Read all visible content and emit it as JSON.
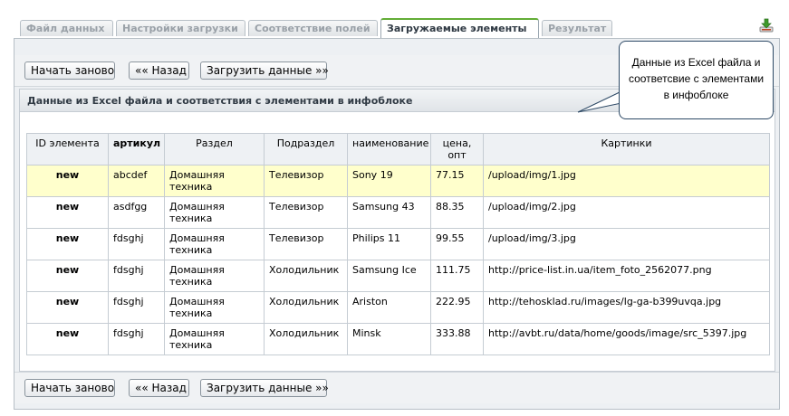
{
  "tabs": [
    {
      "label": "Файл данных",
      "active": false
    },
    {
      "label": "Настройки загрузки",
      "active": false
    },
    {
      "label": "Соответствие полей",
      "active": false
    },
    {
      "label": "Загружаемые элементы",
      "active": true
    },
    {
      "label": "Результат",
      "active": false
    }
  ],
  "toolbar": {
    "restart_label": "Начать заново",
    "back_label": "«« Назад",
    "upload_label": "Загрузить данные »»"
  },
  "section": {
    "title": "Данные из Excel файла и соответствия с элементами в инфоблоке"
  },
  "table": {
    "headers": [
      "ID элемента",
      "артикул",
      "Раздел",
      "Подраздел",
      "наименование",
      "цена, опт",
      "Картинки"
    ],
    "rows": [
      {
        "id": "new",
        "article": "abcdef",
        "section": "Домашняя техника",
        "subsection": "Телевизор",
        "name": "Sony 19",
        "price": "77.15",
        "image": "/upload/img/1.jpg",
        "highlighted": true
      },
      {
        "id": "new",
        "article": "asdfgg",
        "section": "Домашняя техника",
        "subsection": "Телевизор",
        "name": "Samsung 43",
        "price": "88.35",
        "image": "/upload/img/2.jpg",
        "highlighted": false
      },
      {
        "id": "new",
        "article": "fdsghj",
        "section": "Домашняя техника",
        "subsection": "Телевизор",
        "name": "Philips 11",
        "price": "99.55",
        "image": "/upload/img/3.jpg",
        "highlighted": false
      },
      {
        "id": "new",
        "article": "fdsghj",
        "section": "Домашняя техника",
        "subsection": "Холодильник",
        "name": "Samsung Ice",
        "price": "111.75",
        "image": "http://price-list.in.ua/item_foto_2562077.png",
        "highlighted": false
      },
      {
        "id": "new",
        "article": "fdsghj",
        "section": "Домашняя техника",
        "subsection": "Холодильник",
        "name": "Ariston",
        "price": "222.95",
        "image": "http://tehosklad.ru/images/lg-ga-b399uvqa.jpg",
        "highlighted": false
      },
      {
        "id": "new",
        "article": "fdsghj",
        "section": "Домашняя техника",
        "subsection": "Холодильник",
        "name": "Minsk",
        "price": "333.88",
        "image": "http://avbt.ru/data/home/goods/image/src_5397.jpg",
        "highlighted": false
      }
    ]
  },
  "callout": {
    "text": "Данные из Excel файла и соответсвие с элементами в инфоблоке"
  },
  "icons": {
    "export": "download-arrow-icon"
  },
  "colors": {
    "active_tab_accent": "#63ad36",
    "row_highlight": "#ffffcc"
  }
}
